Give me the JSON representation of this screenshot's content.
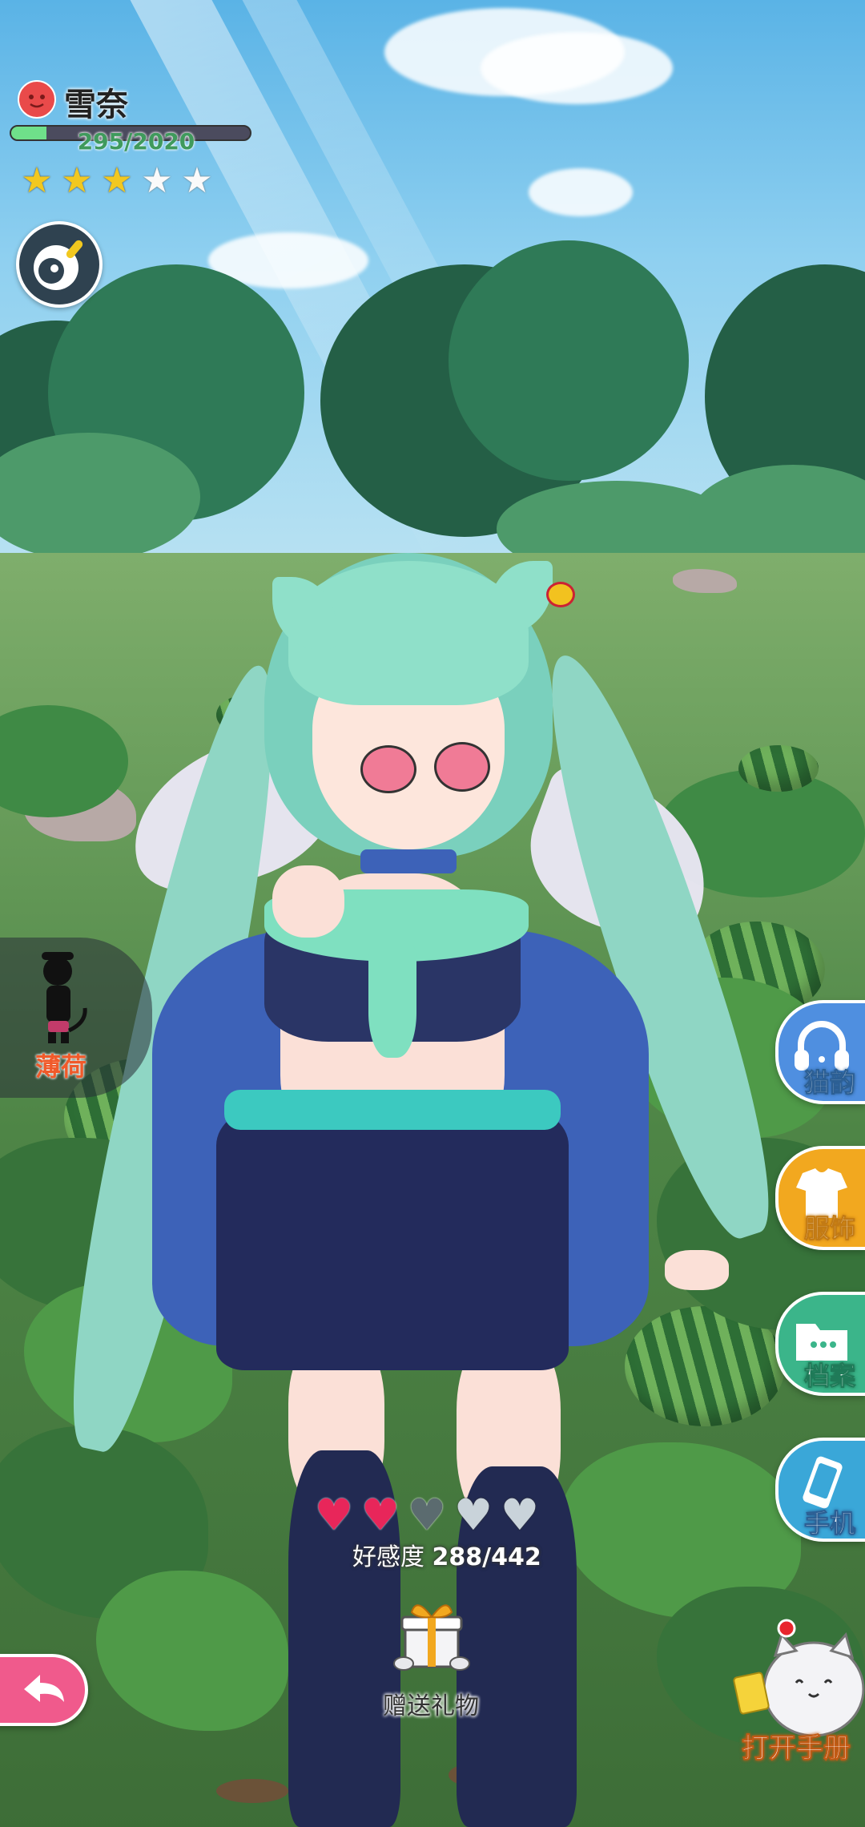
{
  "character": {
    "name": "雪奈",
    "exp_text": "295/2020",
    "exp_progress": 0.146,
    "stars_total": 5,
    "stars_filled": 3
  },
  "switcher": {
    "label": "薄荷"
  },
  "side_menu": [
    {
      "label": "猫韵",
      "icon": "headphones-icon",
      "color": "#4f8fe0"
    },
    {
      "label": "服饰",
      "icon": "clothes-icon",
      "color": "#f2a81f"
    },
    {
      "label": "档案",
      "icon": "folder-icon",
      "color": "#3bb58a"
    },
    {
      "label": "手机",
      "icon": "phone-icon",
      "color": "#3aa7d8"
    }
  ],
  "affection": {
    "label": "好感度",
    "value": "288/442",
    "hearts_total": 5,
    "hearts_full": 2
  },
  "gift": {
    "label": "赠送礼物"
  },
  "handbook": {
    "label": "打开手册"
  },
  "colors": {
    "accent_pink": "#f05a8c",
    "exp_fill": "#6fe08a",
    "heart_full": "#e8265a",
    "star_on": "#f2c81f"
  }
}
